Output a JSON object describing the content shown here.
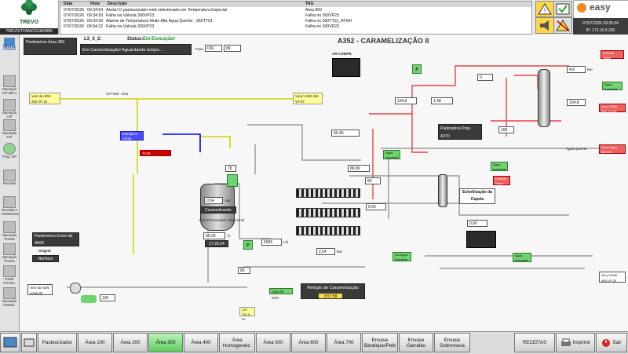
{
  "header": {
    "brand": "TREVO",
    "user": "TREVO/TOMACIO/ADMIN",
    "alarm_columns": [
      "Data",
      "Hora",
      "Descrição",
      "TAG"
    ],
    "alarms": [
      {
        "date": "07/07/2026",
        "time": "09:34:54",
        "desc": "Alerta! O pasteurizador está selecionado em Temperatura Especial",
        "tag": "Área 800"
      },
      {
        "date": "07/07/2026",
        "time": "09:34:30",
        "desc": "Falha na Válvula 300VP23",
        "tag": "Falha no 300VP23"
      },
      {
        "date": "07/07/2026",
        "time": "09:34:30",
        "desc": "Alarme de Temperatura Muito Alta Água Quente - 360TT01",
        "tag": "Falha no 360TT01_ATHH"
      },
      {
        "date": "07/07/2026",
        "time": "09:34:22",
        "desc": "Falha na Válvula 300VP23",
        "tag": "Falha no 300VP23"
      }
    ],
    "app_brand": "easy",
    "datetime": "07/07/2026 09:35:04",
    "ip": "IP: 172.16.6.250"
  },
  "nav": {
    "menu_label": "Menu",
    "items": [
      "Operação CIP 350 A",
      "Operação CIP",
      "Operação CIP",
      "Prog. CIP",
      "Receitas",
      "Receitas e Parâmetros",
      "Operação Prensa",
      "Operação Prensa",
      "Transf. Fermen.",
      "Operação Pasteur."
    ]
  },
  "main": {
    "title": "A352 - CARAMELIZAÇÃO II",
    "params_area": "Parâmetros Área 350",
    "step_code": "L3_3_2:",
    "status_label": "Status:",
    "status_value": "Em Execução!",
    "message": "Em Caramelização! Aguardando tempo...",
    "phase_label": "Fase",
    "phase_value": "036",
    "phase_extra": "89",
    "params_envio": "Parâmetros Envio da A500",
    "origem_label": "Origem",
    "origem_value": "Nenhum",
    "params_prep": "Parâmetros Prep. A370",
    "esterilizacao": "Esterilização da Capela",
    "relogio_title": "Relógio de Caramelização",
    "relogio_value": "3:57:58",
    "caramelizando": "Caramelizando",
    "tanque_nome": "Licor Fermentado Tradicional",
    "vem_a351": "Vem da A351 250-VP-10",
    "vai_a450": "Vai p/ A450 454-VP-07",
    "vem_a300": "Vem da A300 Linha-02",
    "vai_a450b": "Vai p/ A450 455-VP-25",
    "vai_a350": "Vai p/ A350 350-TQ-14",
    "entrada_ar": "Entrada Ar Comp.",
    "entrada_vapor": "Entrada Vapor",
    "agua_industrial": "Água Industrial",
    "agua_quente": "Água Quente",
    "vai_agua_quente": "Vai p/ Água Quente",
    "cip_label": "CIP-600 - E01",
    "ar_compr": "AR COMPR.",
    "values": {
      "v_pct1": "78",
      "v_pct2": "100",
      "v_pct3": "100",
      "v_pct4": "85",
      "v_pct5": "80",
      "v_pct6": "0",
      "level_bar": "0,54",
      "temp_c1": "85,00",
      "time1": "17:26:34",
      "flow": "5005",
      "flow_unit": "L/h",
      "press1": "2,54",
      "temp_c2": "86,80",
      "temp_c3": "90,40",
      "temp_c4": "104,6",
      "bar1": "1,48",
      "bar2": "0,66",
      "temp_c5": "104,8",
      "bar3": "4,8",
      "lh2": "0,00",
      "prep_temp": "70,00",
      "p_unit_bar": "Bar",
      "p_unit_c": "ºC",
      "p_unit_pct": "%"
    }
  },
  "footer": {
    "buttons": [
      "Pasteurizador",
      "Área 100",
      "Área 200",
      "Área 300",
      "Área 400",
      "Área Homogeneiz.",
      "Área 500",
      "Área 600",
      "Área 700",
      "Envase Bandejas/Petit",
      "Envase Garrafas",
      "Envase Sobremesa"
    ],
    "active_index": 3,
    "receitas": "RECEITAS",
    "imprimir": "Imprimir",
    "sair": "Sair"
  }
}
